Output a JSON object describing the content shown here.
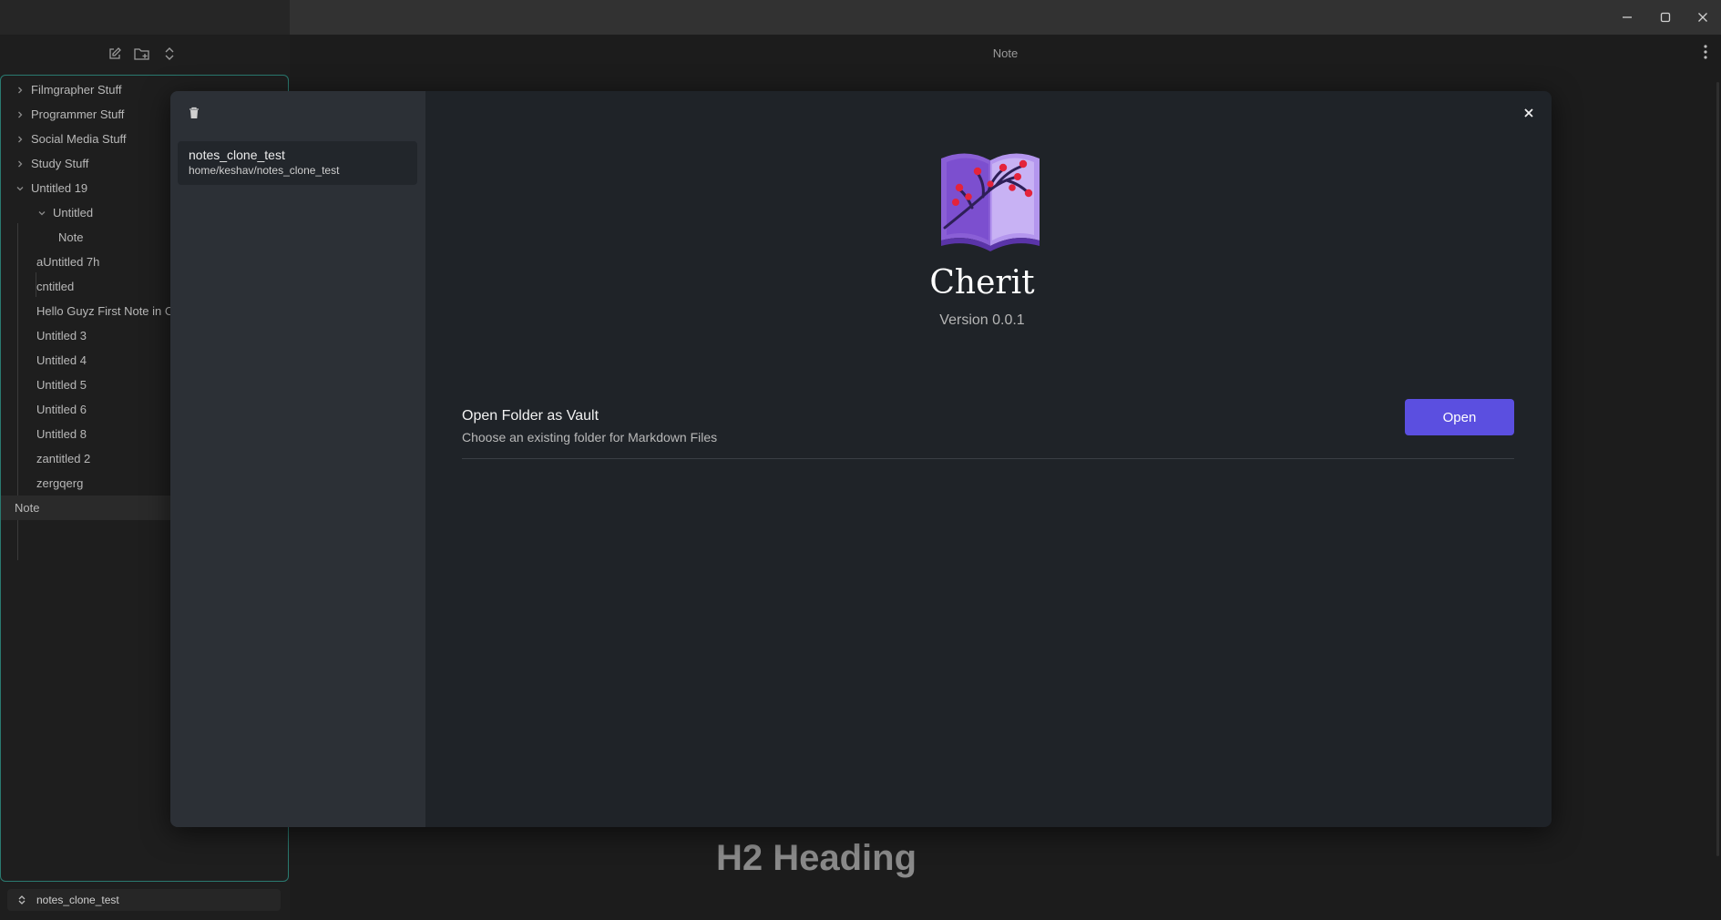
{
  "window": {
    "controls": [
      "minimize-icon",
      "maximize-icon",
      "close-icon"
    ]
  },
  "sidebar": {
    "tools": [
      "new-note-icon",
      "new-folder-icon",
      "collapse-expand-icon"
    ],
    "tree": [
      {
        "label": "Filmgrapher Stuff",
        "type": "folder",
        "expanded": false,
        "depth": 0
      },
      {
        "label": "Programmer Stuff",
        "type": "folder",
        "expanded": false,
        "depth": 0
      },
      {
        "label": "Social Media Stuff",
        "type": "folder",
        "expanded": false,
        "depth": 0
      },
      {
        "label": "Study Stuff",
        "type": "folder",
        "expanded": false,
        "depth": 0
      },
      {
        "label": "Untitled 19",
        "type": "folder",
        "expanded": true,
        "depth": 0
      },
      {
        "label": "Untitled",
        "type": "folder",
        "expanded": true,
        "depth": 1
      },
      {
        "label": "Note",
        "type": "file",
        "depth": 2
      },
      {
        "label": "aUntitled 7h",
        "type": "file",
        "depth": 1
      },
      {
        "label": "cntitled",
        "type": "file",
        "depth": 1
      },
      {
        "label": "Hello Guyz First Note in C",
        "type": "file",
        "depth": 1
      },
      {
        "label": "Untitled 3",
        "type": "file",
        "depth": 1
      },
      {
        "label": "Untitled 4",
        "type": "file",
        "depth": 1
      },
      {
        "label": "Untitled 5",
        "type": "file",
        "depth": 1
      },
      {
        "label": "Untitled 6",
        "type": "file",
        "depth": 1
      },
      {
        "label": "Untitled 8",
        "type": "file",
        "depth": 1
      },
      {
        "label": "zantitled 2",
        "type": "file",
        "depth": 1
      },
      {
        "label": "zergqerg",
        "type": "file",
        "depth": 1
      },
      {
        "label": "Note",
        "type": "file",
        "depth": 0,
        "active": true
      }
    ],
    "vault_switcher": {
      "label": "notes_clone_test",
      "icon": "chevron-up-down-icon"
    }
  },
  "editor": {
    "title": "Note",
    "heading": "H2 Heading"
  },
  "modal": {
    "vaults": [
      {
        "name": "notes_clone_test",
        "path": "home/keshav/notes_clone_test"
      }
    ],
    "app_name": "Cherit",
    "version": "Version 0.0.1",
    "open_folder": {
      "title": "Open Folder as Vault",
      "description": "Choose an existing folder for Markdown Files",
      "button_label": "Open"
    },
    "close_label": "×"
  },
  "colors": {
    "accent": "#5b4fe0",
    "tree_border": "#2a7a70",
    "modal_bg": "#1f2328",
    "modal_sidebar_bg": "#2c3036"
  }
}
